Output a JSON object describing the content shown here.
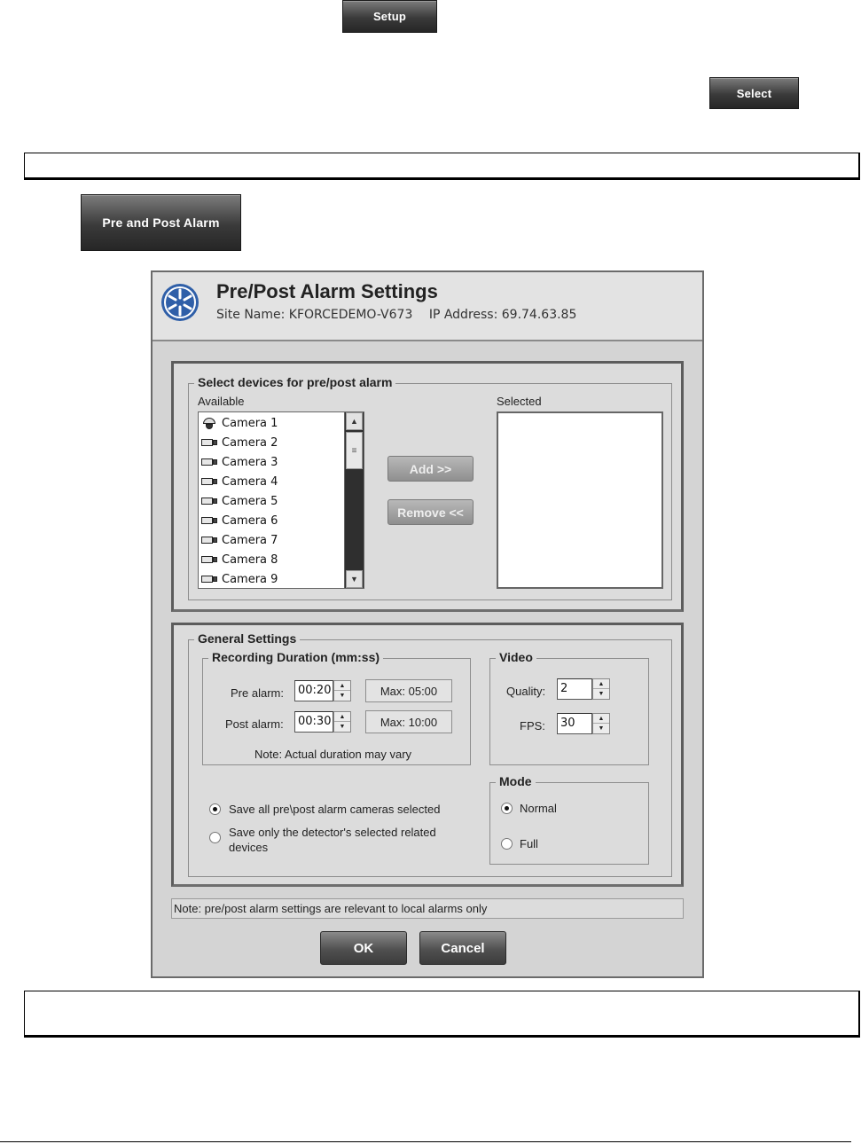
{
  "buttons": {
    "setup": "Setup",
    "select": "Select",
    "pre_post_alarm": "Pre and Post Alarm"
  },
  "dialog": {
    "title": "Pre/Post Alarm Settings",
    "site_name": "Site Name: KFORCEDEMO-V673",
    "ip_address": "IP Address: 69.74.63.85",
    "devices_group": "Select devices for pre/post alarm",
    "available_label": "Available",
    "selected_label": "Selected",
    "cameras": [
      "Camera 1",
      "Camera 2",
      "Camera 3",
      "Camera  4",
      "Camera  5",
      "Camera  6",
      "Camera  7",
      "Camera  8",
      "Camera  9"
    ],
    "add_button": "Add >>",
    "remove_button": "Remove <<",
    "general_group": "General Settings",
    "recording_group": "Recording Duration (mm:ss)",
    "pre_alarm_label": "Pre alarm:",
    "pre_alarm_value": "00:20",
    "pre_alarm_max": "Max: 05:00",
    "post_alarm_label": "Post alarm:",
    "post_alarm_value": "00:30",
    "post_alarm_max": "Max: 10:00",
    "duration_note": "Note: Actual duration may vary",
    "video_group": "Video",
    "quality_label": "Quality:",
    "quality_value": "2",
    "fps_label": "FPS:",
    "fps_value": "30",
    "save_all_label": "Save all pre\\post alarm cameras selected",
    "save_only_label_line1": "Save only the detector's selected related",
    "save_only_label_line2": "devices",
    "mode_group": "Mode",
    "mode_normal": "Normal",
    "mode_full": "Full",
    "footer_note": "Note: pre/post alarm settings are relevant to local alarms only",
    "ok_button": "OK",
    "cancel_button": "Cancel"
  },
  "colors": {
    "dialog_bg": "#d4d4d4",
    "dark_button": "#3a3a3a",
    "logo_blue": "#2f5fa8"
  }
}
